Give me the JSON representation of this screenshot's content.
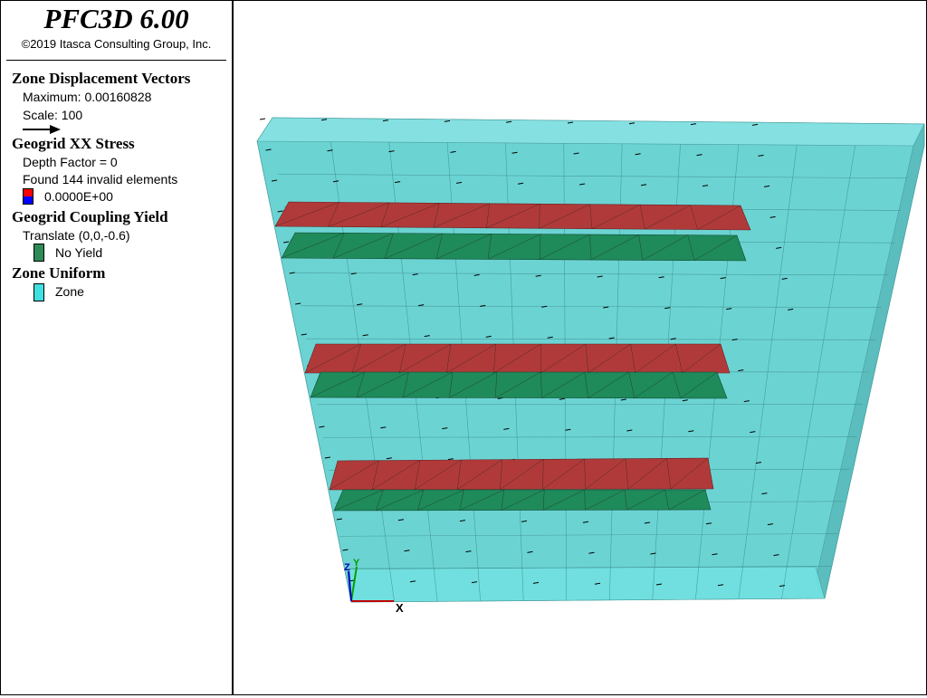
{
  "app": {
    "title": "PFC3D 6.00",
    "copyright": "©2019 Itasca Consulting Group, Inc."
  },
  "legend": {
    "displacement": {
      "heading": "Zone Displacement Vectors",
      "maximum": "Maximum: 0.00160828",
      "scale": "Scale: 100"
    },
    "stress": {
      "heading": "Geogrid XX Stress",
      "depth": "Depth Factor = 0",
      "invalid": "Found 144 invalid elements",
      "value": "0.0000E+00",
      "color_top": "#ff0000",
      "color_bottom": "#0000ff"
    },
    "coupling": {
      "heading": "Geogrid Coupling Yield",
      "translate": "Translate (0,0,-0.6)",
      "no_yield": "No Yield",
      "color": "#2e8b57"
    },
    "zone": {
      "heading": "Zone Uniform",
      "label": "Zone",
      "color": "#40e0e0"
    }
  },
  "axes": {
    "x": "X",
    "y": "Y",
    "z": "Z"
  },
  "colors": {
    "zone_fill": "#5fcfcf",
    "geogrid_stress": "#b03a3a",
    "geogrid_coupling": "#1f8a5a"
  }
}
